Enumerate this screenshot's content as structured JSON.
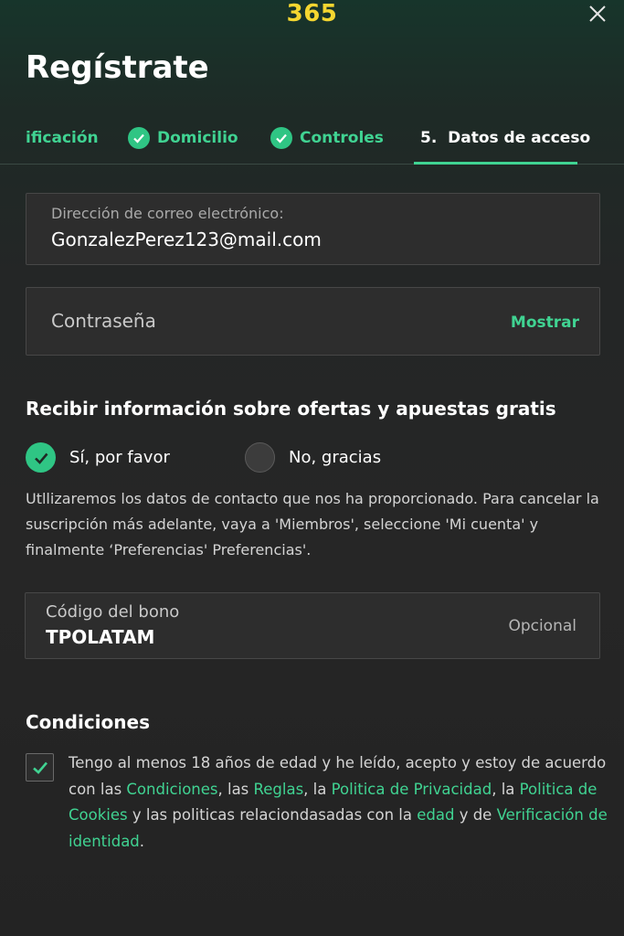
{
  "header": {
    "logo": "365",
    "title": "Regístrate"
  },
  "steps": [
    {
      "label": "ificación",
      "done": false
    },
    {
      "label": "Domicilio",
      "done": true
    },
    {
      "label": "Controles",
      "done": true
    },
    {
      "label": "5.  Datos de acceso",
      "active": true
    }
  ],
  "email": {
    "label": "Dirección de correo electrónico:",
    "value": "GonzalezPerez123@mail.com"
  },
  "password": {
    "placeholder": "Contraseña",
    "show_label": "Mostrar"
  },
  "offers": {
    "title": "Recibir información sobre ofertas y apuestas gratis",
    "yes_label": "Sí, por favor",
    "no_label": "No, gracias",
    "selected": "yes",
    "info": "Utllizaremos los datos de contacto que nos ha proporcionado. Para cancelar la suscripción más adelante, vaya a 'Miembros', seleccione 'Mi cuenta' y finalmente ‘Preferencias' Preferencias'."
  },
  "bonus": {
    "label": "Código del bono",
    "value": "TPOLATAM",
    "optional_label": "Opcional"
  },
  "conditions": {
    "title": "Condiciones",
    "checked": true,
    "text_1": "Tengo al menos 18 años de edad y he leído, acepto y estoy de acuerdo con las ",
    "link_conditions": "Condiciones",
    "text_2": ", las ",
    "link_rules": "Reglas",
    "text_3": ", la ",
    "link_privacy": "Politica de Privacidad",
    "text_4": ", la ",
    "link_cookies": "Politica de Cookies",
    "text_5": " y las politicas relaciondasadas con la ",
    "link_age": "edad",
    "text_6": " y de ",
    "link_identity": "Verificación de identidad",
    "text_7": "."
  },
  "colors": {
    "accent": "#40d392",
    "logo": "#f5d630"
  }
}
